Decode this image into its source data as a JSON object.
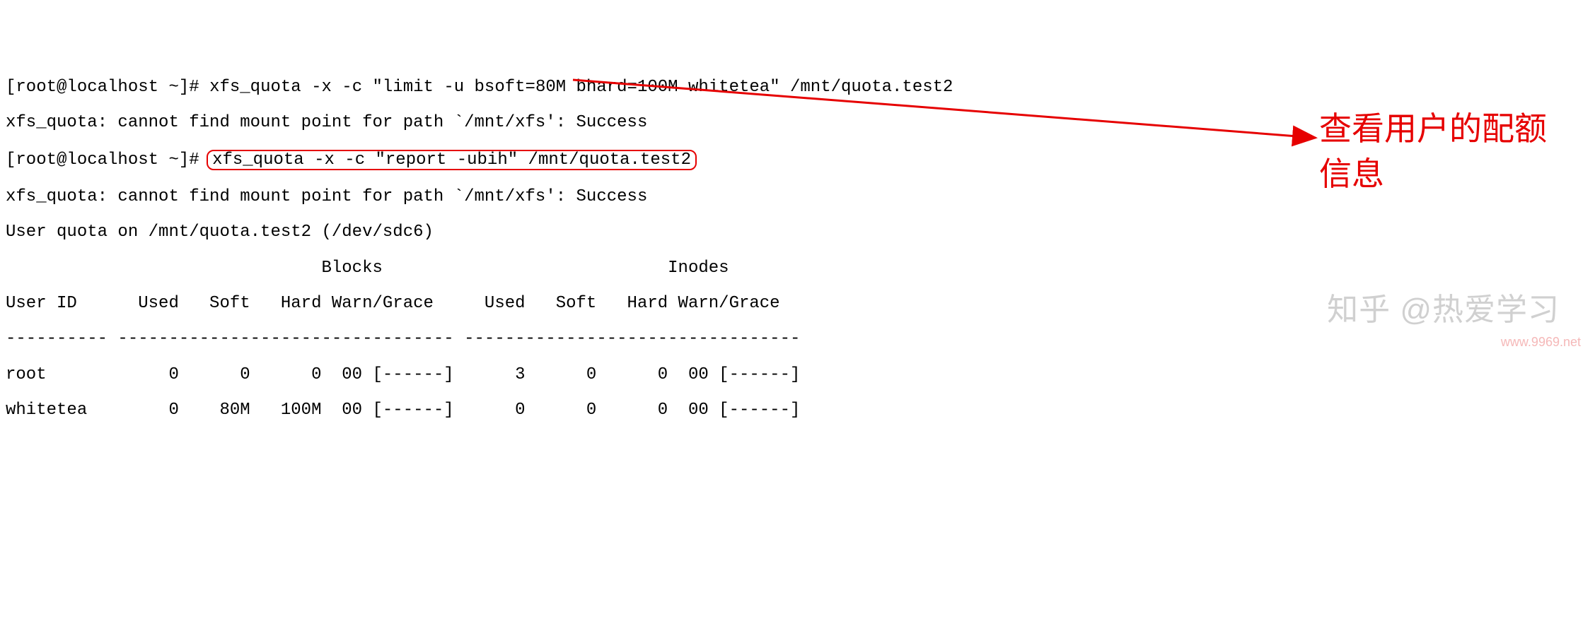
{
  "terminal": {
    "prompt": "[root@localhost ~]#",
    "cmd1": "xfs_quota -x -c \"limit -u bsoft=80M bhard=100M whitetea\" /mnt/quota.test2",
    "err1": "xfs_quota: cannot find mount point for path `/mnt/xfs': Success",
    "cmd2": "xfs_quota -x -c \"report -ubih\" /mnt/quota.test2",
    "err2": "xfs_quota: cannot find mount point for path `/mnt/xfs': Success",
    "title": "User quota on /mnt/quota.test2 (/dev/sdc6)",
    "hdr1": "                               Blocks                            Inodes",
    "hdr2": "User ID      Used   Soft   Hard Warn/Grace     Used   Soft   Hard Warn/Grace",
    "sep": "---------- --------------------------------- ---------------------------------",
    "r1": "root            0      0      0  00 [------]      3      0      0  00 [------]",
    "r2": "whitetea        0    80M   100M  00 [------]      0      0      0  00 [------]"
  },
  "annot": {
    "text": "查看用户的配额信息"
  },
  "wm": {
    "zhihu": "知乎 @热爱学习",
    "url": "www.9969.net"
  }
}
